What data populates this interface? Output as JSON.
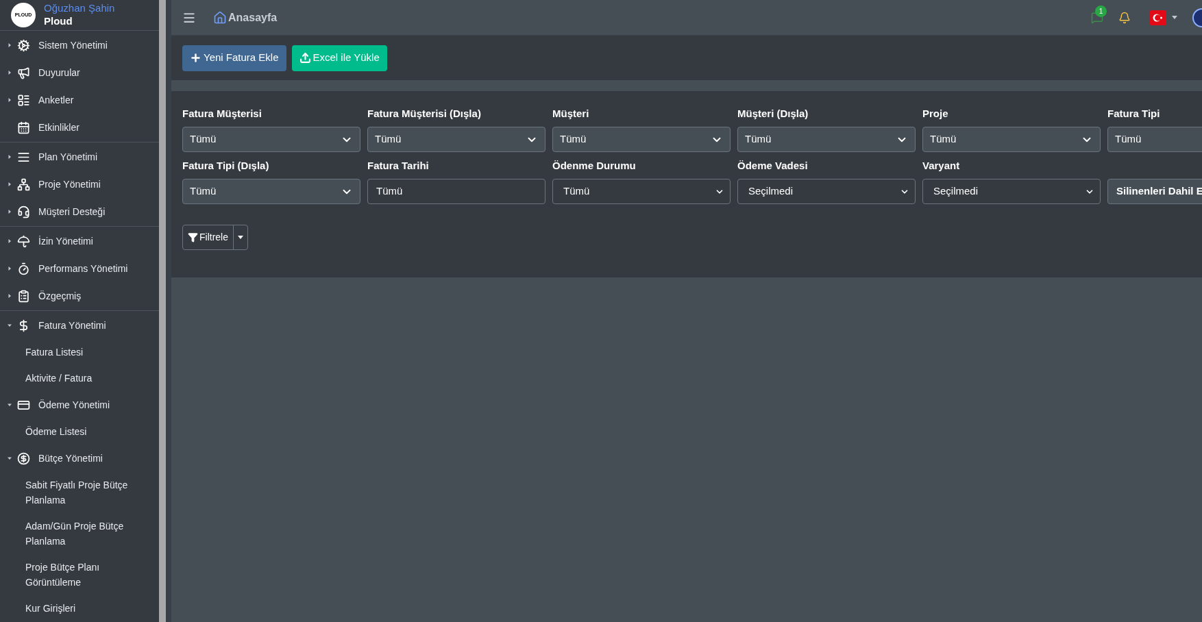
{
  "sidebar": {
    "logo_text": "PLOUD",
    "user_name": "Oğuzhan Şahin",
    "company": "Ploud",
    "groups": [
      {
        "items": [
          {
            "label": "Sistem Yönetimi",
            "kind": "menu",
            "expanded": false
          },
          {
            "label": "Duyurular",
            "kind": "menu",
            "expanded": false
          },
          {
            "label": "Anketler",
            "kind": "menu",
            "expanded": false
          },
          {
            "label": "Etkinlikler",
            "kind": "link"
          }
        ]
      },
      {
        "items": [
          {
            "label": "Plan Yönetimi",
            "kind": "menu",
            "expanded": false
          },
          {
            "label": "Proje Yönetimi",
            "kind": "menu",
            "expanded": false
          },
          {
            "label": "Müşteri Desteği",
            "kind": "menu",
            "expanded": false
          }
        ]
      },
      {
        "items": [
          {
            "label": "İzin Yönetimi",
            "kind": "menu",
            "expanded": false
          },
          {
            "label": "Performans Yönetimi",
            "kind": "menu",
            "expanded": false
          },
          {
            "label": "Özgeçmiş",
            "kind": "menu",
            "expanded": false
          }
        ]
      },
      {
        "items": [
          {
            "label": "Fatura Yönetimi",
            "kind": "menu",
            "expanded": true,
            "children": [
              {
                "label": "Fatura Listesi"
              },
              {
                "label": "Aktivite / Fatura"
              }
            ]
          },
          {
            "label": "Ödeme Yönetimi",
            "kind": "menu",
            "expanded": true,
            "children": [
              {
                "label": "Ödeme Listesi"
              }
            ]
          },
          {
            "label": "Bütçe Yönetimi",
            "kind": "menu",
            "expanded": true,
            "children": [
              {
                "label": "Sabit Fiyatlı Proje Bütçe Planlama"
              },
              {
                "label": "Adam/Gün Proje Bütçe Planlama"
              },
              {
                "label": "Proje Bütçe Planı Görüntüleme"
              },
              {
                "label": "Kur Girişleri"
              }
            ]
          }
        ]
      }
    ]
  },
  "topbar": {
    "title": "Anasayfa",
    "message_count": "1"
  },
  "actions": [
    {
      "label": "Yeni Fatura Ekle",
      "kind": "add"
    },
    {
      "label": "Excel ile Yükle",
      "kind": "upload"
    }
  ],
  "filters": [
    {
      "label": "Fatura Müşterisi",
      "kind": "dropdown",
      "value": "Tümü"
    },
    {
      "label": "Fatura Müşterisi (Dışla)",
      "kind": "dropdown",
      "value": "Tümü"
    },
    {
      "label": "Müşteri",
      "kind": "dropdown",
      "value": "Tümü"
    },
    {
      "label": "Müşteri (Dışla)",
      "kind": "dropdown",
      "value": "Tümü"
    },
    {
      "label": "Proje",
      "kind": "dropdown",
      "value": "Tümü"
    },
    {
      "label": "Fatura Tipi",
      "kind": "dropdown",
      "value": "Tümü"
    },
    {
      "label": "Fatura Tipi (Dışla)",
      "kind": "dropdown",
      "value": "Tümü"
    },
    {
      "label": "Fatura Tarihi",
      "kind": "text",
      "value": "Tümü"
    },
    {
      "label": "Ödenme Durumu",
      "kind": "select",
      "value": "Tümü"
    },
    {
      "label": "Ödeme Vadesi",
      "kind": "select",
      "value": "Seçilmedi"
    },
    {
      "label": "Varyant",
      "kind": "select",
      "value": "Seçilmedi"
    },
    {
      "kind": "toggle",
      "value": "Silinenleri Dahil E"
    }
  ],
  "filter_button": {
    "label": "Filtrele"
  }
}
